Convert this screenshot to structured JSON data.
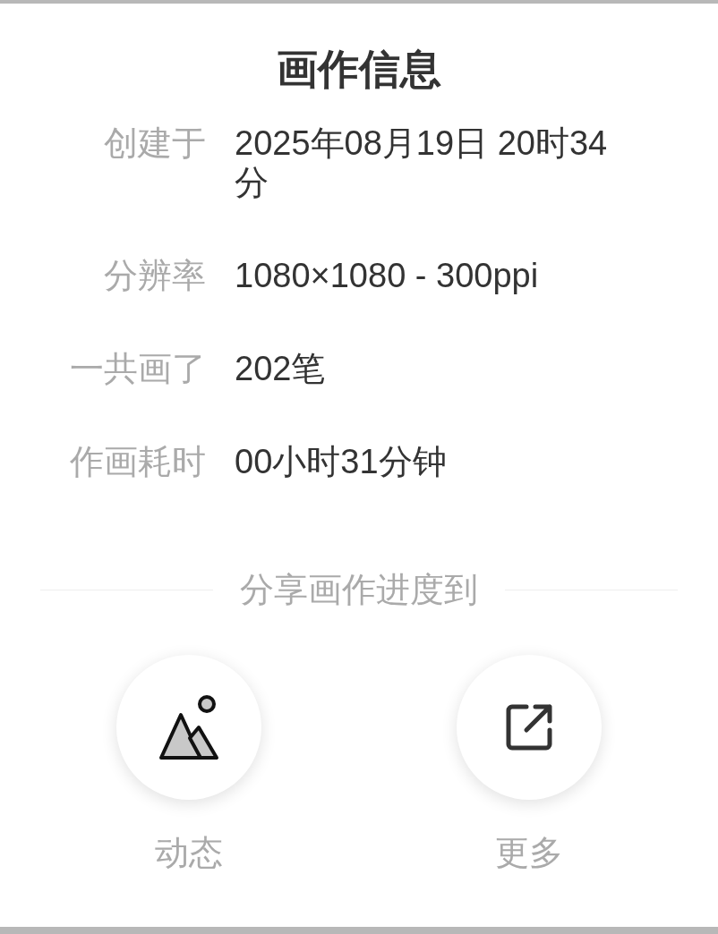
{
  "title": "画作信息",
  "info_rows": [
    {
      "label": "创建于",
      "value": "2025年08月19日 20时34分"
    },
    {
      "label": "分辨率",
      "value": "1080×1080 - 300ppi"
    },
    {
      "label": "一共画了",
      "value": "202笔"
    },
    {
      "label": "作画耗时",
      "value": "00小时31分钟"
    }
  ],
  "share_heading": "分享画作进度到",
  "share_targets": [
    {
      "kind": "moments",
      "label": "动态"
    },
    {
      "kind": "more",
      "label": "更多"
    }
  ]
}
